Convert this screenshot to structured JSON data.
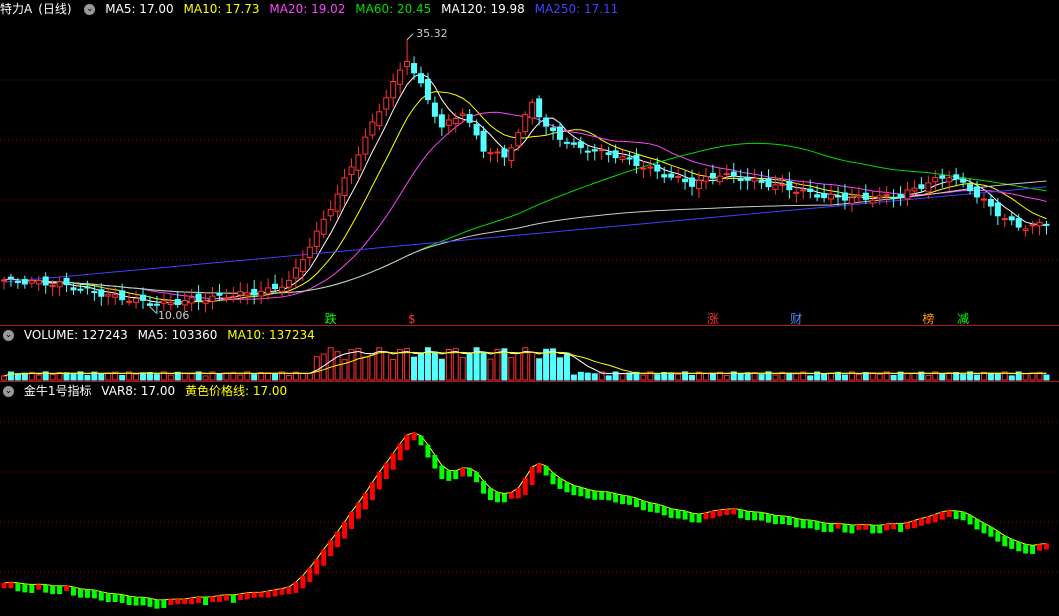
{
  "colors": {
    "up": "#ff3232",
    "down": "#54ffff",
    "grid": "#8b0000",
    "ma5": "#ffffff",
    "ma10": "#ffff00",
    "ma20": "#ff44ff",
    "ma60": "#00dd00",
    "ma120": "#ffffff",
    "ma250": "#4040ff",
    "ind_up": "#ff0000",
    "ind_down": "#00ff00"
  },
  "main": {
    "title": "特力A",
    "period": "(日线)",
    "ma5": "MA5: 17.00",
    "ma10": "MA10: 17.73",
    "ma20": "MA20: 19.02",
    "ma60": "MA60: 20.45",
    "ma120": "MA120: 19.98",
    "ma250": "MA250: 17.11",
    "high_label": "35.32",
    "low_label": "10.06",
    "events": [
      {
        "text": "跌",
        "color": "#00ff00",
        "idx": 47
      },
      {
        "text": "$",
        "color": "#ff3232",
        "idx": 59
      },
      {
        "text": "涨",
        "color": "#ff3232",
        "idx": 102
      },
      {
        "text": "财",
        "color": "#4a8cff",
        "idx": 114
      },
      {
        "text": "榜",
        "color": "#ff9900",
        "idx": 133
      },
      {
        "text": "减",
        "color": "#00ff00",
        "idx": 138
      }
    ]
  },
  "volume": {
    "title": "VOLUME: 127243",
    "ma5": "MA5: 103360",
    "ma10": "MA10: 137234"
  },
  "indicator": {
    "title": "金牛1号指标",
    "var8": "VAR8: 17.00",
    "price_line": "黄色价格线: 17.00"
  }
}
